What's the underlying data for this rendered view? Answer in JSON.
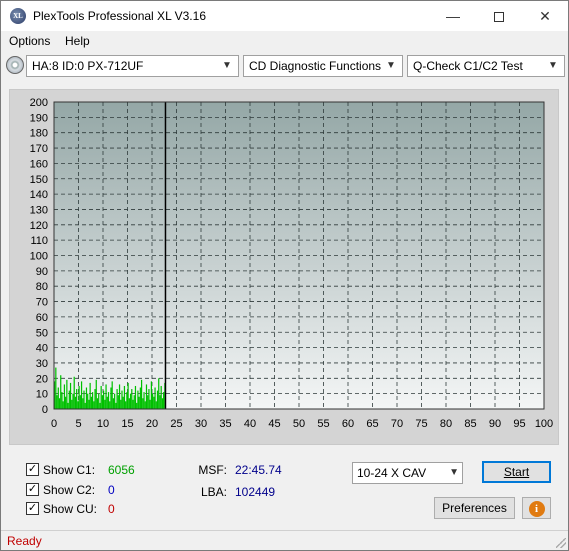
{
  "window": {
    "title": "PlexTools Professional XL V3.16",
    "app_icon_text": "XL",
    "controls": {
      "minimize": "—",
      "close": "✕"
    }
  },
  "menu": {
    "items": [
      {
        "label": "Options"
      },
      {
        "label": "Help"
      }
    ]
  },
  "toolbar": {
    "drive": "HA:8 ID:0  PX-712UF",
    "function": "CD Diagnostic Functions",
    "test": "Q-Check C1/C2 Test",
    "dropdown_arrow": "▼"
  },
  "chart_data": {
    "type": "bar",
    "x_ticks": [
      "0",
      "5",
      "10",
      "15",
      "20",
      "25",
      "30",
      "35",
      "40",
      "45",
      "50",
      "55",
      "60",
      "65",
      "70",
      "75",
      "80",
      "85",
      "90",
      "95",
      "100"
    ],
    "y_ticks": [
      "0",
      "10",
      "20",
      "30",
      "40",
      "50",
      "60",
      "70",
      "80",
      "90",
      "100",
      "110",
      "120",
      "130",
      "140",
      "150",
      "160",
      "170",
      "180",
      "190",
      "200"
    ],
    "xlim": [
      0,
      100
    ],
    "ylim": [
      0,
      200
    ],
    "grid": true,
    "cursor_x": 22.75,
    "series": [
      {
        "color": "#00c000",
        "x": [
          0.0,
          0.25,
          0.5,
          0.75,
          1.0,
          1.25,
          1.5,
          1.75,
          2.0,
          2.25,
          2.5,
          2.75,
          3.0,
          3.25,
          3.5,
          3.75,
          4.0,
          4.25,
          4.5,
          4.75,
          5.0,
          5.25,
          5.5,
          5.75,
          6.0,
          6.25,
          6.5,
          6.75,
          7.0,
          7.25,
          7.5,
          7.75,
          8.0,
          8.25,
          8.5,
          8.75,
          9.0,
          9.25,
          9.5,
          9.75,
          10.0,
          10.25,
          10.5,
          10.75,
          11.0,
          11.25,
          11.5,
          11.75,
          12.0,
          12.25,
          12.5,
          12.75,
          13.0,
          13.25,
          13.5,
          13.75,
          14.0,
          14.25,
          14.5,
          14.75,
          15.0,
          15.25,
          15.5,
          15.75,
          16.0,
          16.25,
          16.5,
          16.75,
          17.0,
          17.25,
          17.5,
          17.75,
          18.0,
          18.25,
          18.5,
          18.75,
          19.0,
          19.25,
          19.5,
          19.75,
          20.0,
          20.25,
          20.5,
          20.75,
          21.0,
          21.25,
          21.5,
          21.75,
          22.0,
          22.25,
          22.5
        ],
        "values": [
          18,
          27,
          9,
          14,
          7,
          22,
          11,
          5,
          16,
          8,
          19,
          4,
          12,
          17,
          6,
          10,
          21,
          8,
          13,
          5,
          15,
          9,
          18,
          7,
          12,
          4,
          14,
          10,
          6,
          17,
          8,
          11,
          5,
          13,
          19,
          7,
          10,
          4,
          15,
          9,
          12,
          6,
          16,
          8,
          11,
          5,
          14,
          18,
          7,
          10,
          4,
          13,
          9,
          16,
          6,
          12,
          8,
          15,
          5,
          11,
          17,
          7,
          10,
          13,
          6,
          9,
          15,
          4,
          12,
          8,
          14,
          19,
          7,
          11,
          5,
          16,
          9,
          13,
          6,
          18,
          10,
          8,
          14,
          5,
          12,
          20,
          9,
          15,
          7,
          11,
          17
        ]
      }
    ]
  },
  "stats": {
    "c1": {
      "label": "Show C1:",
      "value": "6056",
      "checked": "✓"
    },
    "c2": {
      "label": "Show C2:",
      "value": "0",
      "checked": "✓"
    },
    "cu": {
      "label": "Show CU:",
      "value": "0",
      "checked": "✓"
    },
    "msf_label": "MSF:",
    "msf_value": "22:45.74",
    "lba_label": "LBA:",
    "lba_value": "102449"
  },
  "controls": {
    "speed": "10-24 X CAV",
    "start_label": "Start",
    "preferences_label": "Preferences",
    "info_icon": "i"
  },
  "status": {
    "text": "Ready"
  }
}
